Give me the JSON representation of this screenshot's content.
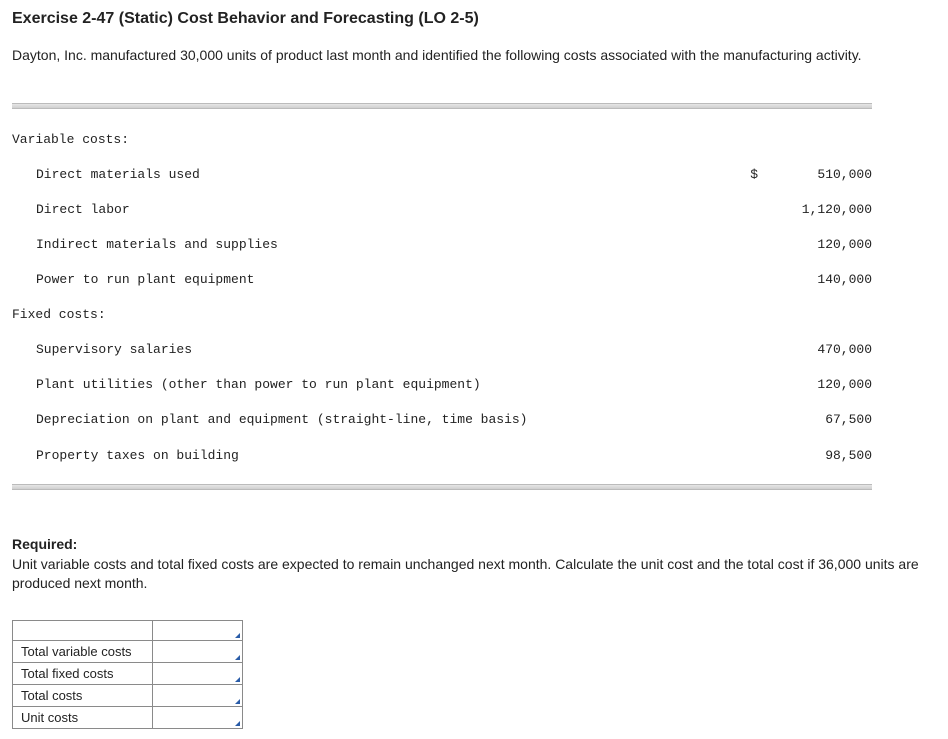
{
  "title": "Exercise 2-47 (Static) Cost Behavior and Forecasting (LO 2-5)",
  "intro": "Dayton, Inc. manufactured 30,000 units of product last month and identified the following costs associated with the manufacturing activity.",
  "costs": {
    "variable_heading": "Variable costs:",
    "variable": [
      {
        "label": "Direct materials used",
        "sym": "$",
        "value": "510,000"
      },
      {
        "label": "Direct labor",
        "sym": "",
        "value": "1,120,000"
      },
      {
        "label": "Indirect materials and supplies",
        "sym": "",
        "value": "120,000"
      },
      {
        "label": "Power to run plant equipment",
        "sym": "",
        "value": "140,000"
      }
    ],
    "fixed_heading": "Fixed costs:",
    "fixed": [
      {
        "label": "Supervisory salaries",
        "sym": "",
        "value": "470,000"
      },
      {
        "label": "Plant utilities (other than power to run plant equipment)",
        "sym": "",
        "value": "120,000"
      },
      {
        "label": "Depreciation on plant and equipment (straight-line, time basis)",
        "sym": "",
        "value": "67,500"
      },
      {
        "label": "Property taxes on building",
        "sym": "",
        "value": "98,500"
      }
    ]
  },
  "required": {
    "label": "Required:",
    "text": "Unit variable costs and total fixed costs are expected to remain unchanged next month. Calculate the unit cost and the total cost if 36,000 units are produced next month."
  },
  "answer_rows": [
    "Total variable costs",
    "Total fixed costs",
    "Total costs",
    "Unit costs"
  ]
}
